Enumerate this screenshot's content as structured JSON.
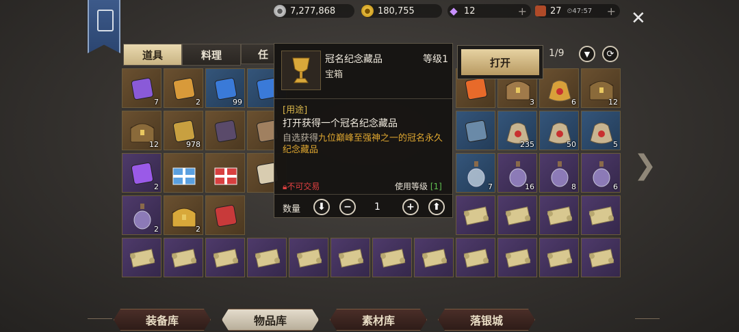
{
  "currencies": {
    "silver": "7,277,868",
    "gold": "180,755",
    "gems": "12",
    "tickets": "27",
    "timer": "47:57"
  },
  "tabs": [
    "道具",
    "料理",
    "任"
  ],
  "page": "1/9",
  "popup": {
    "item_name": "冠名纪念藏品",
    "level_label": "等级1",
    "item_type": "宝箱",
    "usage_header": "[用途]",
    "usage_text": "打开获得一个冠名纪念藏品",
    "desc_prefix": "自选获得",
    "desc_highlight": "九位巅峰至强神之一的冠名永久纪念藏品",
    "trade": "不可交易",
    "use_level_label": "使用等级",
    "use_level_value": "[1]",
    "quantity_label": "数量",
    "quantity": "1"
  },
  "open_button": "打开",
  "grid": [
    {
      "kind": "brown",
      "icon": "purple-scroll-icon",
      "count": "7"
    },
    {
      "kind": "brown",
      "icon": "pumpkin-scroll-icon",
      "count": "2"
    },
    {
      "kind": "blue",
      "icon": "blue-card-icon",
      "count": "99"
    },
    {
      "kind": "blue",
      "icon": "blue-card-icon",
      "count": ""
    },
    {
      "kind": "hidden"
    },
    {
      "kind": "hidden"
    },
    {
      "kind": "hidden"
    },
    {
      "kind": "hidden"
    },
    {
      "kind": "brown",
      "icon": "orange-feather-icon",
      "count": ""
    },
    {
      "kind": "brown",
      "icon": "wooden-chest-icon",
      "count": "3"
    },
    {
      "kind": "brown",
      "icon": "gold-sack-icon",
      "count": "6"
    },
    {
      "kind": "brown",
      "icon": "treasure-chest-icon",
      "count": "12"
    },
    {
      "kind": "brown",
      "icon": "treasure-chest-icon",
      "count": "12"
    },
    {
      "kind": "brown",
      "icon": "gold-relic-icon",
      "count": "978"
    },
    {
      "kind": "brown",
      "icon": "dark-emblem-icon",
      "count": ""
    },
    {
      "kind": "brown",
      "icon": "relic-icon",
      "count": ""
    },
    {
      "kind": "hidden"
    },
    {
      "kind": "hidden"
    },
    {
      "kind": "hidden"
    },
    {
      "kind": "hidden"
    },
    {
      "kind": "blue",
      "icon": "toolkit-icon",
      "count": ""
    },
    {
      "kind": "blue",
      "icon": "grain-sack-icon",
      "count": "235"
    },
    {
      "kind": "blue",
      "icon": "grain-sack-icon",
      "count": "50"
    },
    {
      "kind": "blue",
      "icon": "grain-sack-icon",
      "count": "5"
    },
    {
      "kind": "purple",
      "icon": "purple-card-icon",
      "count": "2"
    },
    {
      "kind": "brown",
      "icon": "blue-gift-icon",
      "count": ""
    },
    {
      "kind": "brown",
      "icon": "red-gift-icon",
      "count": ""
    },
    {
      "kind": "brown",
      "icon": "document-icon",
      "count": ""
    },
    {
      "kind": "hidden"
    },
    {
      "kind": "hidden"
    },
    {
      "kind": "hidden"
    },
    {
      "kind": "hidden"
    },
    {
      "kind": "blue",
      "icon": "message-bottle-icon",
      "count": "7"
    },
    {
      "kind": "purple",
      "icon": "potion-bottle-icon",
      "count": "16"
    },
    {
      "kind": "purple",
      "icon": "potion-bottle-icon",
      "count": "8"
    },
    {
      "kind": "purple",
      "icon": "potion-bottle-icon",
      "count": "6"
    },
    {
      "kind": "purple",
      "icon": "potion-bottle-icon",
      "count": "2"
    },
    {
      "kind": "brown",
      "icon": "golden-chest-icon",
      "count": "2"
    },
    {
      "kind": "brown",
      "icon": "red-envelope-icon",
      "count": ""
    },
    {
      "kind": "hidden"
    },
    {
      "kind": "hidden"
    },
    {
      "kind": "hidden"
    },
    {
      "kind": "hidden"
    },
    {
      "kind": "hidden"
    },
    {
      "kind": "purple",
      "icon": "map-scroll-icon",
      "count": ""
    },
    {
      "kind": "purple",
      "icon": "map-scroll-icon",
      "count": ""
    },
    {
      "kind": "purple",
      "icon": "map-scroll-icon",
      "count": ""
    },
    {
      "kind": "purple",
      "icon": "map-scroll-icon",
      "count": ""
    },
    {
      "kind": "purple",
      "icon": "map-scroll-icon",
      "count": ""
    },
    {
      "kind": "purple",
      "icon": "map-scroll-icon",
      "count": ""
    },
    {
      "kind": "purple",
      "icon": "map-scroll-icon",
      "count": ""
    },
    {
      "kind": "purple",
      "icon": "map-scroll-icon",
      "count": ""
    },
    {
      "kind": "purple",
      "icon": "map-scroll-icon",
      "count": ""
    },
    {
      "kind": "purple",
      "icon": "map-scroll-icon",
      "count": ""
    },
    {
      "kind": "purple",
      "icon": "map-scroll-icon",
      "count": ""
    },
    {
      "kind": "purple",
      "icon": "map-scroll-icon",
      "count": ""
    },
    {
      "kind": "purple",
      "icon": "map-scroll-icon",
      "count": ""
    },
    {
      "kind": "purple",
      "icon": "map-scroll-icon",
      "count": ""
    },
    {
      "kind": "purple",
      "icon": "map-scroll-icon",
      "count": ""
    },
    {
      "kind": "purple",
      "icon": "map-scroll-icon",
      "count": ""
    }
  ],
  "bottom_tabs": [
    "装备库",
    "物品库",
    "素材库",
    "落银城"
  ],
  "colors": {
    "accent": "#e6d2a2",
    "highlight": "#e0a830",
    "usage": "#d9b64a",
    "trade": "#e04040",
    "green": "#5fc050"
  }
}
